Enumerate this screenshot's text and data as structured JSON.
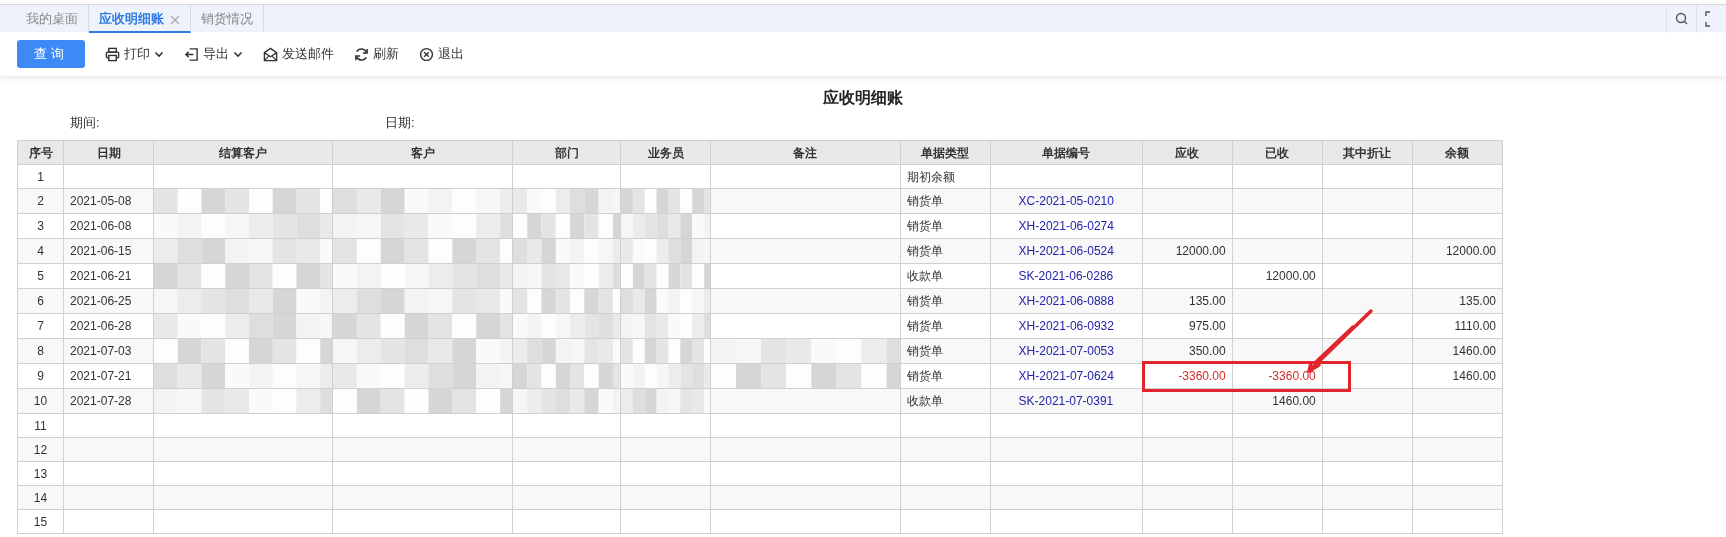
{
  "tabs": [
    {
      "label": "我的桌面",
      "selected": false,
      "closable": false
    },
    {
      "label": "应收明细账",
      "selected": true,
      "closable": true
    },
    {
      "label": "销货情况",
      "selected": false,
      "closable": false
    }
  ],
  "toolbar": {
    "query_button": "查询",
    "actions": [
      {
        "kind": "print",
        "label": "打印",
        "dropdown": true
      },
      {
        "kind": "export",
        "label": "导出",
        "dropdown": true
      },
      {
        "kind": "mail",
        "label": "发送邮件",
        "dropdown": false
      },
      {
        "kind": "refresh",
        "label": "刷新",
        "dropdown": false
      },
      {
        "kind": "exit",
        "label": "退出",
        "dropdown": false
      }
    ]
  },
  "report": {
    "title": "应收明细账",
    "period_label": "期间:",
    "date_label": "日期:"
  },
  "table": {
    "columns": [
      "序号",
      "日期",
      "结算客户",
      "客户",
      "部门",
      "业务员",
      "备注",
      "单据类型",
      "单据编号",
      "应收",
      "已收",
      "其中折让",
      "余额"
    ],
    "rows": [
      {
        "no": "1",
        "date": "",
        "doc_type": "期初余额",
        "doc_no": "",
        "receivable": "",
        "received": "",
        "discount": "",
        "balance": "",
        "redacted": false,
        "remark_redacted": false,
        "annotated": false
      },
      {
        "no": "2",
        "date": "2021-05-08",
        "doc_type": "销货单",
        "doc_no": "XC-2021-05-0210",
        "receivable": "",
        "received": "",
        "discount": "",
        "balance": "",
        "redacted": true,
        "remark_redacted": false,
        "alert": false,
        "annotated": false
      },
      {
        "no": "3",
        "date": "2021-06-08",
        "doc_type": "销货单",
        "doc_no": "XH-2021-06-0274",
        "receivable": "",
        "received": "",
        "discount": "",
        "balance": "",
        "redacted": true,
        "remark_redacted": false,
        "alert": false,
        "annotated": false
      },
      {
        "no": "4",
        "date": "2021-06-15",
        "doc_type": "销货单",
        "doc_no": "XH-2021-06-0524",
        "receivable": "12000.00",
        "received": "",
        "discount": "",
        "balance": "12000.00",
        "redacted": true,
        "remark_redacted": false,
        "alert": false,
        "annotated": false
      },
      {
        "no": "5",
        "date": "2021-06-21",
        "doc_type": "收款单",
        "doc_no": "SK-2021-06-0286",
        "receivable": "",
        "received": "12000.00",
        "discount": "",
        "balance": "",
        "redacted": true,
        "remark_redacted": false,
        "alert": false,
        "annotated": false
      },
      {
        "no": "6",
        "date": "2021-06-25",
        "doc_type": "销货单",
        "doc_no": "XH-2021-06-0888",
        "receivable": "135.00",
        "received": "",
        "discount": "",
        "balance": "135.00",
        "redacted": true,
        "remark_redacted": false,
        "alert": false,
        "annotated": false
      },
      {
        "no": "7",
        "date": "2021-06-28",
        "doc_type": "销货单",
        "doc_no": "XH-2021-06-0932",
        "receivable": "975.00",
        "received": "",
        "discount": "",
        "balance": "1110.00",
        "redacted": true,
        "remark_redacted": false,
        "alert": false,
        "annotated": false
      },
      {
        "no": "8",
        "date": "2021-07-03",
        "doc_type": "销货单",
        "doc_no": "XH-2021-07-0053",
        "receivable": "350.00",
        "received": "",
        "discount": "",
        "balance": "1460.00",
        "redacted": true,
        "remark_redacted": true,
        "alert": false,
        "annotated": false
      },
      {
        "no": "9",
        "date": "2021-07-21",
        "doc_type": "销货单",
        "doc_no": "XH-2021-07-0624",
        "receivable": "-3360.00",
        "received": "-3360.00",
        "discount": "",
        "balance": "1460.00",
        "redacted": true,
        "remark_redacted": true,
        "alert": true,
        "annotated": true
      },
      {
        "no": "10",
        "date": "2021-07-28",
        "doc_type": "收款单",
        "doc_no": "SK-2021-07-0391",
        "receivable": "",
        "received": "1460.00",
        "discount": "",
        "balance": "",
        "redacted": true,
        "remark_redacted": false,
        "alert": false,
        "annotated": false
      },
      {
        "no": "11",
        "date": "",
        "doc_type": "",
        "doc_no": "",
        "receivable": "",
        "received": "",
        "discount": "",
        "balance": "",
        "redacted": false,
        "remark_redacted": false,
        "annotated": false
      },
      {
        "no": "12",
        "date": "",
        "doc_type": "",
        "doc_no": "",
        "receivable": "",
        "received": "",
        "discount": "",
        "balance": "",
        "redacted": false,
        "remark_redacted": false,
        "annotated": false
      },
      {
        "no": "13",
        "date": "",
        "doc_type": "",
        "doc_no": "",
        "receivable": "",
        "received": "",
        "discount": "",
        "balance": "",
        "redacted": false,
        "remark_redacted": false,
        "annotated": false
      },
      {
        "no": "14",
        "date": "",
        "doc_type": "",
        "doc_no": "",
        "receivable": "",
        "received": "",
        "discount": "",
        "balance": "",
        "redacted": false,
        "remark_redacted": false,
        "annotated": false
      },
      {
        "no": "15",
        "date": "",
        "doc_type": "",
        "doc_no": "",
        "receivable": "",
        "received": "",
        "discount": "",
        "balance": "",
        "redacted": false,
        "remark_redacted": false,
        "annotated": false
      }
    ]
  }
}
